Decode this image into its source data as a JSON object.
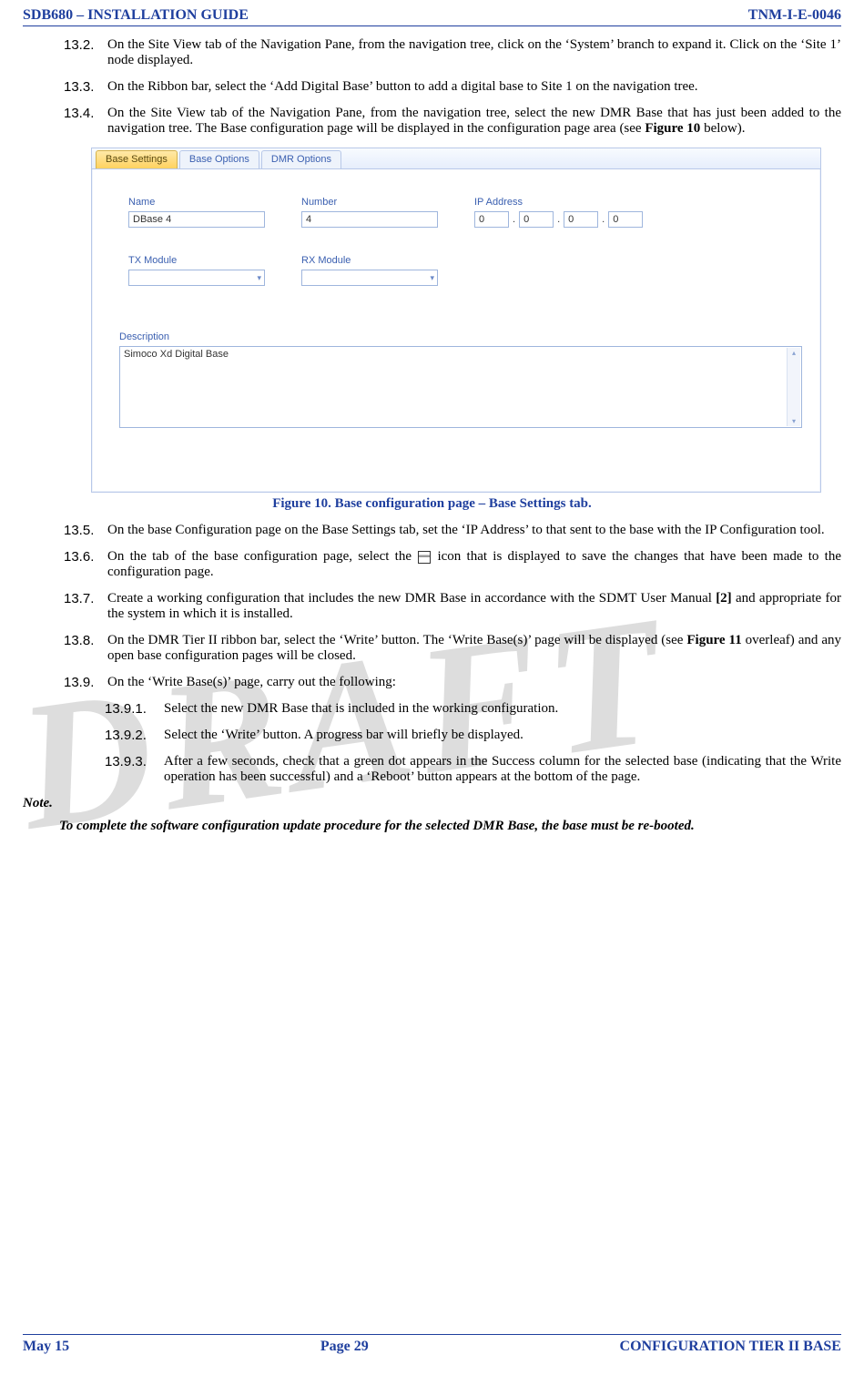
{
  "header": {
    "left": "SDB680 – INSTALLATION GUIDE",
    "right": "TNM-I-E-0046"
  },
  "footer": {
    "left": "May 15",
    "center": "Page 29",
    "right": "CONFIGURATION TIER II BASE"
  },
  "watermark": "DRAFT",
  "steps": {
    "s132": {
      "num": "13.2.",
      "text": "On the Site View tab of the Navigation Pane, from the navigation tree, click on the ‘System’ branch to expand it.  Click on the ‘Site 1’ node displayed."
    },
    "s133": {
      "num": "13.3.",
      "text": "On the Ribbon bar, select the ‘Add Digital Base’ button to add a digital base to Site 1 on the navigation tree."
    },
    "s134": {
      "num": "13.4.",
      "text_a": "On the Site View tab of the Navigation Pane, from the navigation tree, select the new DMR Base that has just been added to the navigation tree.  The Base configuration page will be displayed in the configuration page area (see ",
      "bold": "Figure 10",
      "text_b": " below)."
    },
    "s135": {
      "num": "13.5.",
      "text": "On the base Configuration page on the Base Settings tab, set the ‘IP Address’ to that sent to the base with the IP Configuration tool."
    },
    "s136": {
      "num": "13.6.",
      "text_a": "On the tab of the base configuration page, select the ",
      "text_b": " icon that is displayed to save the changes that have been made to the configuration page."
    },
    "s137": {
      "num": "13.7.",
      "text_a": "Create a working configuration that includes the new DMR Base in accordance with the SDMT User Manual ",
      "bold": "[2]",
      "text_b": " and appropriate for the system in which it is installed."
    },
    "s138": {
      "num": "13.8.",
      "text_a": "On the DMR Tier II ribbon bar, select the ‘Write’ button.  The ‘Write Base(s)’ page will be displayed (see ",
      "bold": "Figure 11",
      "text_b": " overleaf) and any open base configuration pages will be closed."
    },
    "s139": {
      "num": "13.9.",
      "text": "On the ‘Write Base(s)’ page, carry out the following:"
    }
  },
  "substeps": {
    "s1391": {
      "num": "13.9.1.",
      "text": "Select the new DMR Base that is included in the working configuration."
    },
    "s1392": {
      "num": "13.9.2.",
      "text": "Select the ‘Write’ button.  A progress bar will briefly be displayed."
    },
    "s1393": {
      "num": "13.9.3.",
      "text": "After a few seconds, check that a green dot appears in the Success column for the selected base (indicating that the Write operation has been successful) and a ‘Reboot’ button appears at the bottom of the page."
    }
  },
  "figure": {
    "caption": "Figure 10.  Base configuration page – Base Settings tab.",
    "tabs": [
      "Base Settings",
      "Base Options",
      "DMR Options"
    ],
    "labels": {
      "name": "Name",
      "number": "Number",
      "ip": "IP Address",
      "tx": "TX Module",
      "rx": "RX Module",
      "desc": "Description"
    },
    "values": {
      "name": "DBase 4",
      "number": "4",
      "ip": [
        "0",
        "0",
        "0",
        "0"
      ],
      "desc": "Simoco Xd Digital Base"
    }
  },
  "note": {
    "label": "Note.",
    "body": "To complete the software configuration update procedure for the selected DMR Base, the base must be re-booted."
  }
}
